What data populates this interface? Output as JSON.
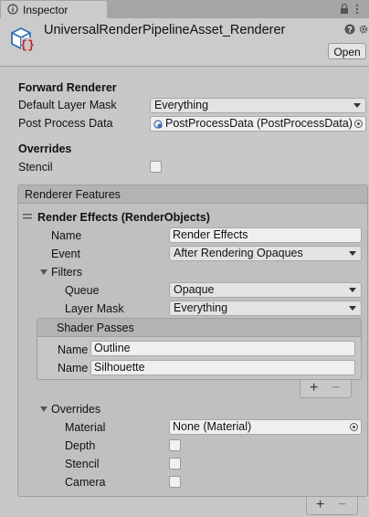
{
  "tab": {
    "title": "Inspector"
  },
  "header": {
    "asset_name": "UniversalRenderPipelineAsset_Renderer",
    "open_label": "Open"
  },
  "forward": {
    "title": "Forward Renderer",
    "default_layer_mask_label": "Default Layer Mask",
    "default_layer_mask_value": "Everything",
    "post_process_label": "Post Process Data",
    "post_process_value": "PostProcessData (PostProcessData)"
  },
  "overrides": {
    "title": "Overrides",
    "stencil_label": "Stencil"
  },
  "renderer_features": {
    "title": "Renderer Features",
    "feature_title": "Render Effects (RenderObjects)",
    "name_label": "Name",
    "name_value": "Render Effects",
    "event_label": "Event",
    "event_value": "After Rendering Opaques",
    "filters_label": "Filters",
    "queue_label": "Queue",
    "queue_value": "Opaque",
    "layer_mask_label": "Layer Mask",
    "layer_mask_value": "Everything",
    "shader_passes": {
      "title": "Shader Passes",
      "items": [
        {
          "label": "Name",
          "value": "Outline"
        },
        {
          "label": "Name",
          "value": "Silhouette"
        }
      ]
    },
    "overrides_label": "Overrides",
    "material_label": "Material",
    "material_value": "None (Material)",
    "depth_label": "Depth",
    "stencil_label": "Stencil",
    "camera_label": "Camera"
  },
  "icons": {
    "help": "?",
    "settings": "⚙",
    "plus": "+",
    "minus": "−",
    "lock": "🔒",
    "menu": "⋮"
  }
}
